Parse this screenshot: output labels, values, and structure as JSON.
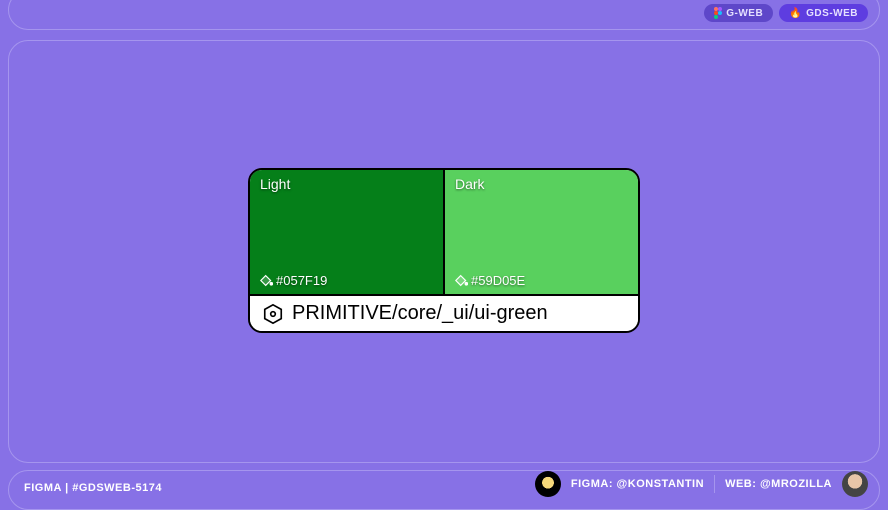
{
  "tags": {
    "gweb": "G-WEB",
    "gdsweb": "GDS-WEB"
  },
  "swatch": {
    "light_label": "Light",
    "light_hex": "#057F19",
    "dark_label": "Dark",
    "dark_hex": "#59D05E",
    "name": "PRIMITIVE/core/_ui/ui-green"
  },
  "footer": {
    "ticket": "FIGMA | #GDSWEB-5174",
    "figma_credit": "FIGMA: @KONSTANTIN",
    "web_credit": "WEB: @MROZILLA"
  }
}
